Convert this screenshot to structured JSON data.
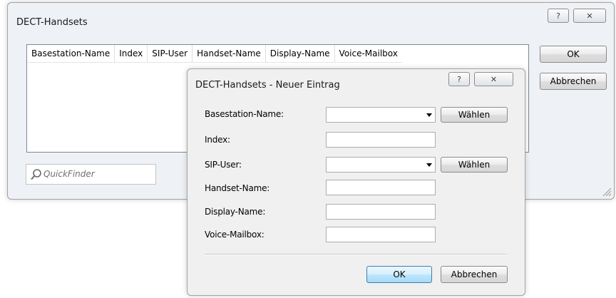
{
  "main_window": {
    "title": "DECT-Handsets",
    "help_glyph": "?",
    "close_glyph": "✕",
    "columns": [
      "Basestation-Name",
      "Index",
      "SIP-User",
      "Handset-Name",
      "Display-Name",
      "Voice-Mailbox"
    ],
    "ok_label": "OK",
    "cancel_label": "Abbrechen",
    "quickfinder_placeholder": "QuickFinder"
  },
  "dialog": {
    "title": "DECT-Handsets - Neuer Eintrag",
    "help_glyph": "?",
    "close_glyph": "✕",
    "fields": {
      "basestation_name": {
        "label": "Basestation-Name:",
        "value": ""
      },
      "index": {
        "label": "Index:",
        "value": ""
      },
      "sip_user": {
        "label": "SIP-User:",
        "value": ""
      },
      "handset_name": {
        "label": "Handset-Name:",
        "value": ""
      },
      "display_name": {
        "label": "Display-Name:",
        "value": ""
      },
      "voice_mailbox": {
        "label": "Voice-Mailbox:",
        "value": ""
      }
    },
    "choose_label": "Wählen",
    "ok_label": "OK",
    "cancel_label": "Abbrechen"
  }
}
